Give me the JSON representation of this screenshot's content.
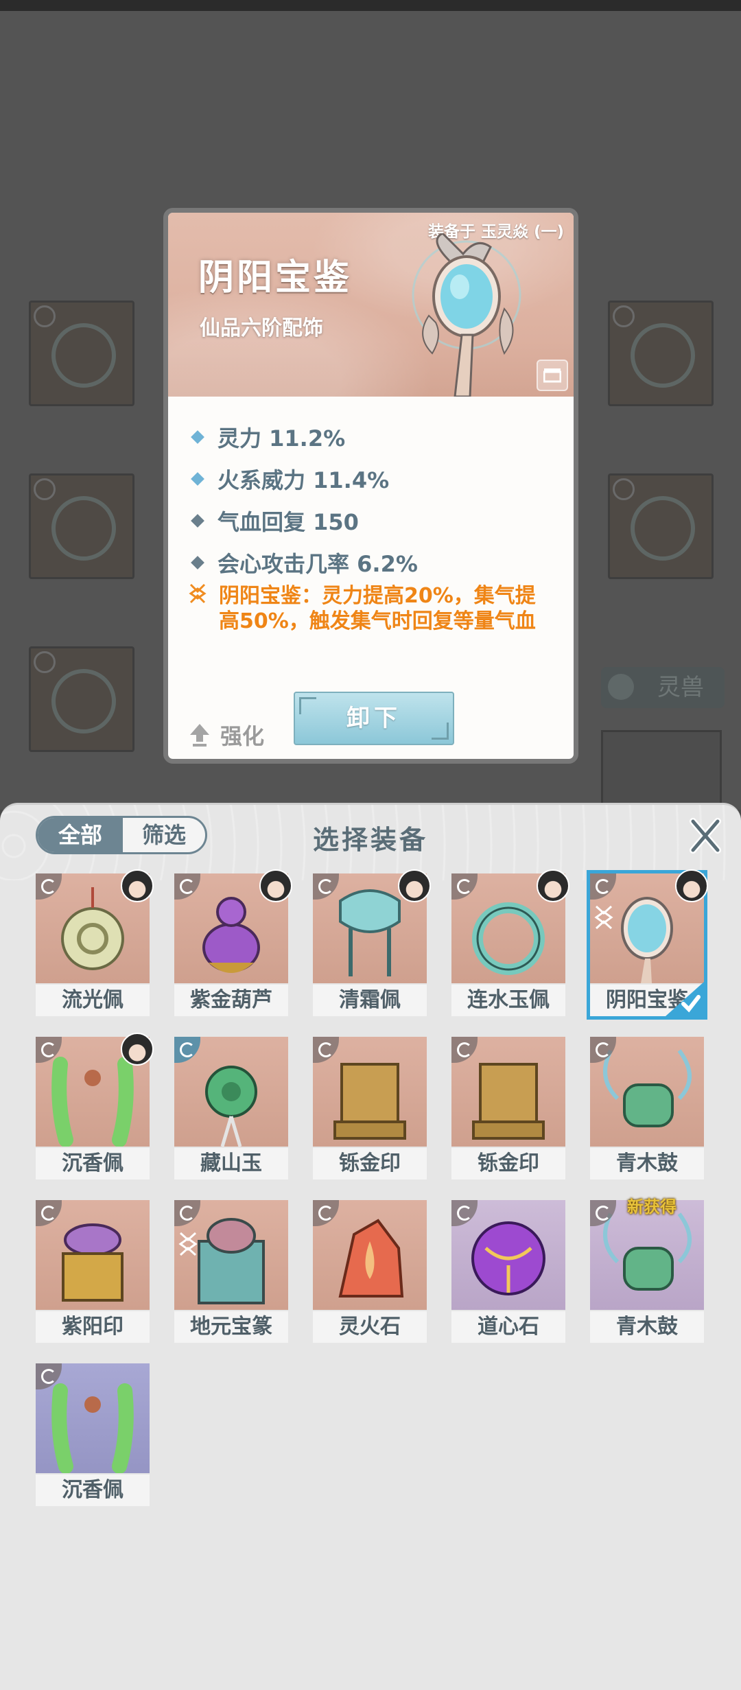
{
  "detail": {
    "equipped_on": "装备于 玉灵焱 (一)",
    "name": "阴阳宝鉴",
    "grade": "仙品六阶配饰",
    "attributes": [
      {
        "text": "灵力 11.2%",
        "style": "blue"
      },
      {
        "text": "火系威力 11.4%",
        "style": "blue"
      },
      {
        "text": "气血回复 150",
        "style": "gray"
      },
      {
        "text": "会心攻击几率 6.2%",
        "style": "gray"
      }
    ],
    "special_line1": "阴阳宝鉴：灵力提高20%，集气提",
    "special_line2": "高50%，触发集气时回复等量气血",
    "strengthen_label": "强化",
    "unequip_label": "卸下"
  },
  "background": {
    "lingshou_label": "灵兽"
  },
  "panel": {
    "tab_all": "全部",
    "tab_filter": "筛选",
    "title": "选择装备",
    "close_icon": "close-icon",
    "items": [
      {
        "name": "流光佩",
        "rarity": "orange",
        "equipped_by_avatar": true,
        "selected": false,
        "new": ""
      },
      {
        "name": "紫金葫芦",
        "rarity": "orange",
        "equipped_by_avatar": true,
        "selected": false,
        "new": ""
      },
      {
        "name": "清霜佩",
        "rarity": "orange",
        "equipped_by_avatar": true,
        "selected": false,
        "new": ""
      },
      {
        "name": "连水玉佩",
        "rarity": "orange",
        "equipped_by_avatar": true,
        "selected": false,
        "new": ""
      },
      {
        "name": "阴阳宝鉴",
        "rarity": "orange",
        "equipped_by_avatar": true,
        "selected": true,
        "new": ""
      },
      {
        "name": "沉香佩",
        "rarity": "orange",
        "equipped_by_avatar": true,
        "selected": false,
        "new": ""
      },
      {
        "name": "藏山玉",
        "rarity": "orange",
        "equipped_by_avatar": false,
        "selected": false,
        "new": ""
      },
      {
        "name": "铄金印",
        "rarity": "orange",
        "equipped_by_avatar": false,
        "selected": false,
        "new": ""
      },
      {
        "name": "铄金印",
        "rarity": "orange",
        "equipped_by_avatar": false,
        "selected": false,
        "new": ""
      },
      {
        "name": "青木鼓",
        "rarity": "orange",
        "equipped_by_avatar": false,
        "selected": false,
        "new": ""
      },
      {
        "name": "紫阳印",
        "rarity": "orange",
        "equipped_by_avatar": false,
        "selected": false,
        "new": ""
      },
      {
        "name": "地元宝篆",
        "rarity": "orange",
        "equipped_by_avatar": false,
        "selected": false,
        "new": ""
      },
      {
        "name": "灵火石",
        "rarity": "orange",
        "equipped_by_avatar": false,
        "selected": false,
        "new": ""
      },
      {
        "name": "道心石",
        "rarity": "purple",
        "equipped_by_avatar": false,
        "selected": false,
        "new": ""
      },
      {
        "name": "青木鼓",
        "rarity": "purple",
        "equipped_by_avatar": false,
        "selected": false,
        "new": "新获得"
      },
      {
        "name": "沉香佩",
        "rarity": "blue",
        "equipped_by_avatar": false,
        "selected": false,
        "new": ""
      }
    ]
  }
}
